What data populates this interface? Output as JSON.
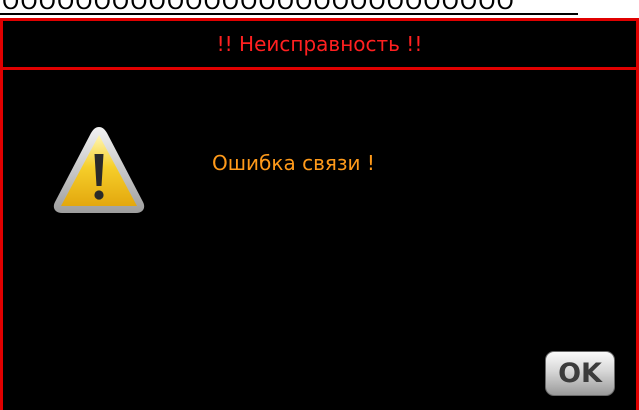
{
  "header": {
    "partial_text": "ОООООООООООООООООООООООООООО"
  },
  "dialog": {
    "title": "!! Неисправность !!",
    "message": "Ошибка связи !",
    "ok_label": "OK",
    "icon": "warning-icon"
  },
  "colors": {
    "background": "#000000",
    "border": "#e00000",
    "title": "#ff2020",
    "message": "#ff9a1a",
    "icon_fill": "#f3c21a",
    "ok_button": "#d6d6d6"
  }
}
